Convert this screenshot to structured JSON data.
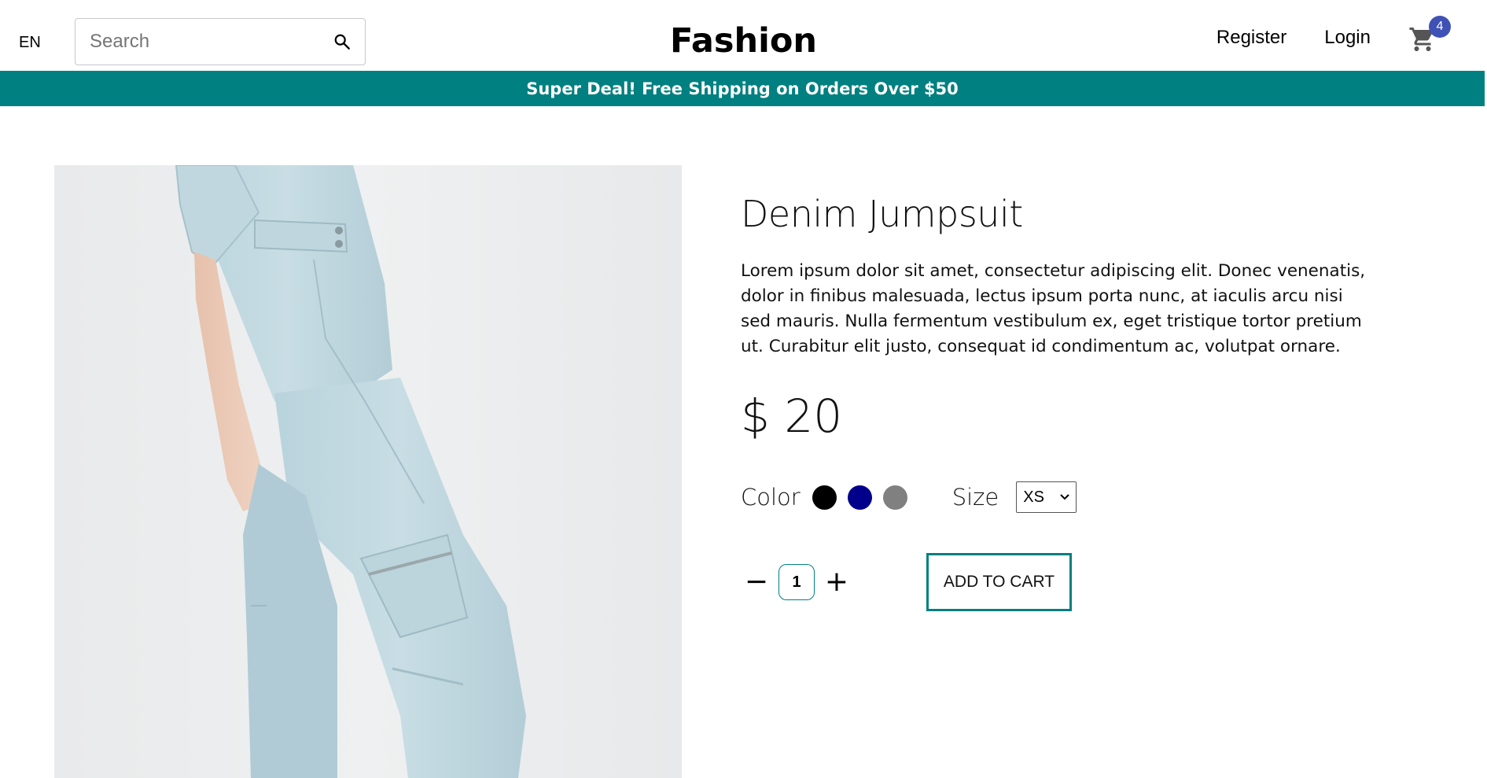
{
  "header": {
    "language": "EN",
    "search_placeholder": "Search",
    "search_value": "",
    "logo": "Fashion",
    "register_label": "Register",
    "login_label": "Login",
    "cart_count": "4",
    "cart_badge_color": "#3f51b5"
  },
  "announcement": {
    "text": "Super Deal! Free Shipping on Orders Over $50",
    "background": "#008080"
  },
  "product": {
    "image_icon": "product-photo",
    "title": "Denim Jumpsuit",
    "description": "Lorem ipsum dolor sit amet, consectetur adipiscing elit. Donec venenatis, dolor in finibus malesuada, lectus ipsum porta nunc, at iaculis arcu nisi sed mauris. Nulla fermentum vestibulum ex, eget tristique tortor pretium ut. Curabitur elit justo, consequat id condimentum ac, volutpat ornare.",
    "price": "$ 20",
    "color_label": "Color",
    "colors": [
      "#000000",
      "#00008b",
      "#808080"
    ],
    "size_label": "Size",
    "size_value": "XS",
    "quantity": "1",
    "minus_label": "−",
    "plus_label": "+",
    "add_to_cart_label": "ADD TO CART"
  }
}
